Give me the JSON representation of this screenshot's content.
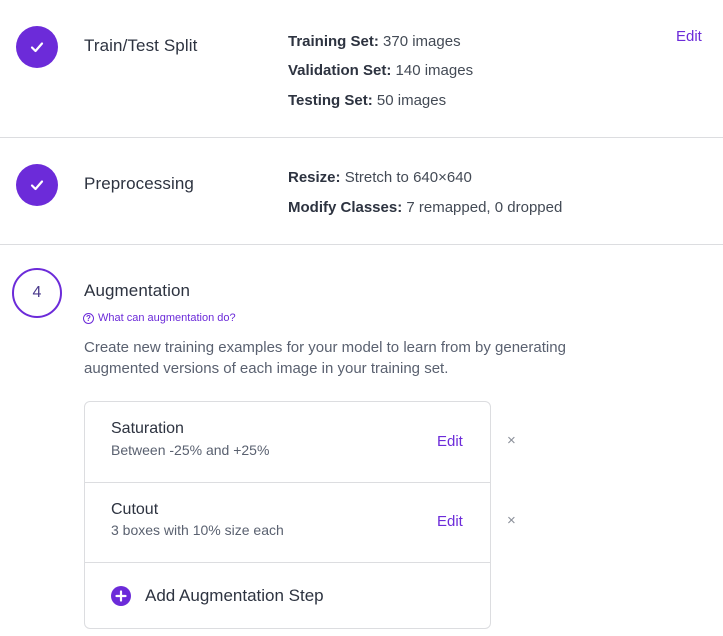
{
  "steps": {
    "split": {
      "title": "Train/Test Split",
      "edit_label": "Edit",
      "details": [
        {
          "key": "Training Set:",
          "value": "370 images"
        },
        {
          "key": "Validation Set:",
          "value": "140 images"
        },
        {
          "key": "Testing Set:",
          "value": "50 images"
        }
      ]
    },
    "preprocessing": {
      "title": "Preprocessing",
      "details": [
        {
          "key": "Resize:",
          "value": "Stretch to 640×640"
        },
        {
          "key": "Modify Classes:",
          "value": "7 remapped, 0 dropped"
        }
      ]
    },
    "augmentation": {
      "number": "4",
      "title": "Augmentation",
      "help_link": "What can augmentation do?",
      "description": "Create new training examples for your model to learn from by generating augmented versions of each image in your training set.",
      "items": [
        {
          "name": "Saturation",
          "detail": "Between -25% and +25%",
          "edit_label": "Edit",
          "remove_label": "×"
        },
        {
          "name": "Cutout",
          "detail": "3 boxes with 10% size each",
          "edit_label": "Edit",
          "remove_label": "×"
        }
      ],
      "add_label": "Add Augmentation Step"
    }
  },
  "colors": {
    "accent": "#6c2bd9",
    "divider": "#dcdde0"
  }
}
